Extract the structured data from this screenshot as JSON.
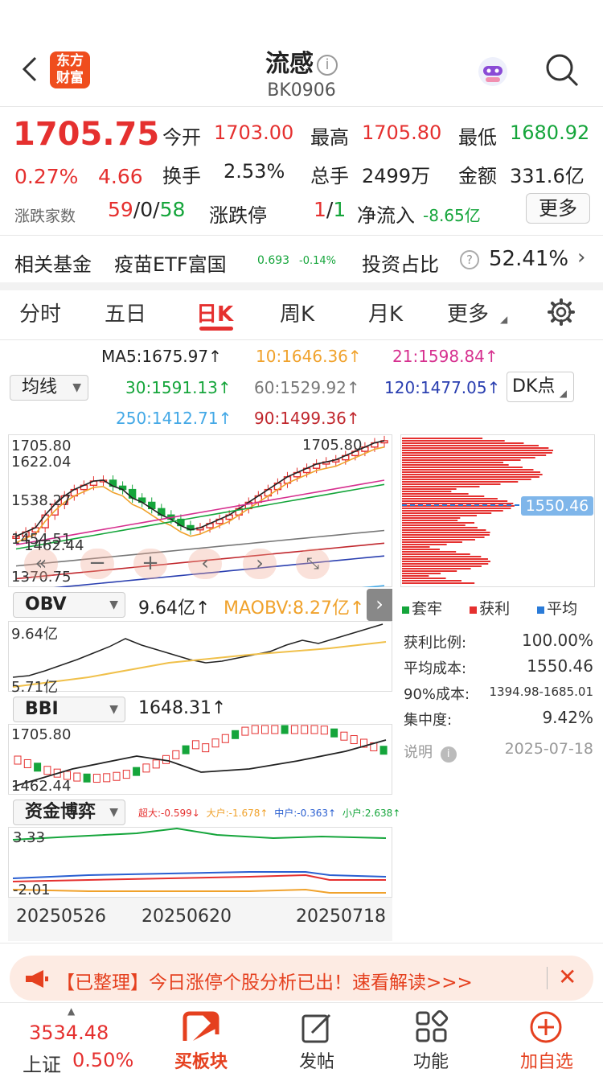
{
  "header": {
    "title": "流感",
    "info_icon": "ⓘ",
    "code": "BK0906",
    "logo_line1": "东方",
    "logo_line2": "财富"
  },
  "quote": {
    "price": "1705.75",
    "pct": "0.27%",
    "chg": "4.66",
    "open_label": "今开",
    "open": "1703.00",
    "high_label": "最高",
    "high": "1705.80",
    "low_label": "最低",
    "low": "1680.92",
    "turnover_label": "换手",
    "turnover": "2.53%",
    "volume_label": "总手",
    "volume": "2499万",
    "amount_label": "金额",
    "amount": "331.6亿",
    "updown_label": "涨跌家数",
    "up_count": "59",
    "flat_count": "0",
    "down_count": "58",
    "slash": "/",
    "limit_label": "涨跌停",
    "limit_up": "1",
    "limit_down": "1",
    "netflow_label": "净流入",
    "netflow": "-8.65亿",
    "more_label": "更多"
  },
  "fund": {
    "label": "相关基金",
    "name": "疫苗ETF富国",
    "price": "0.693",
    "pct": "-0.14%",
    "ratio_label": "投资占比",
    "ratio": "52.41%"
  },
  "tabs": [
    {
      "label": "分时"
    },
    {
      "label": "五日"
    },
    {
      "label": "日K"
    },
    {
      "label": "周K"
    },
    {
      "label": "月K"
    },
    {
      "label": "更多"
    }
  ],
  "ma": {
    "selector": "均线",
    "ma5": "MA5:1675.97↑",
    "ma10": "10:1646.36↑",
    "ma21": "21:1598.84↑",
    "ma30": "30:1591.13↑",
    "ma60": "60:1529.92↑",
    "ma120": "120:1477.05↑",
    "ma250": "250:1412.71↑",
    "ma90": "90:1499.36↑",
    "dk": "DK点"
  },
  "kchart": {
    "y_top": "1705.80",
    "y2": "1622.04",
    "y3": "1538.27",
    "y4": "1454.51",
    "y5": "1462.44",
    "y_bottom": "1370.75",
    "last_label": "1705.80"
  },
  "chip": {
    "avg": "1550.46",
    "legend_trap": "套牢",
    "legend_profit": "获利",
    "legend_avg": "平均",
    "profit_ratio_label": "获利比例:",
    "profit_ratio": "100.00%",
    "avg_cost_label": "平均成本:",
    "avg_cost": "1550.46",
    "cost90_label": "90%成本:",
    "cost90": "1394.98-1685.01",
    "conc_label": "集中度:",
    "conc": "9.42%",
    "note_label": "说明",
    "date": "2025-07-18"
  },
  "obv": {
    "selector": "OBV",
    "value": "9.64亿↑",
    "maobv": "MAOBV:8.27亿↑",
    "y_top": "9.64亿",
    "y_bottom": "5.71亿"
  },
  "bbi": {
    "selector": "BBI",
    "value": "1648.31↑",
    "y_top": "1705.80",
    "y_bottom": "1462.44"
  },
  "fund_game": {
    "selector": "资金博弈",
    "super": "超大:-0.599↓",
    "big": "大户:-1.678↑",
    "mid": "中户:-0.363↑",
    "small": "小户:2.638↑",
    "y_top": "3.33",
    "y_bottom": "-2.01"
  },
  "dates": [
    "20250526",
    "20250620",
    "20250718"
  ],
  "banner": {
    "text": "【已整理】今日涨停个股分析已出！速看解读>>>"
  },
  "bottom": {
    "index_value": "3534.48",
    "index_name": "上证",
    "index_pct": "0.50%",
    "nav": [
      {
        "label": "买板块"
      },
      {
        "label": "发帖"
      },
      {
        "label": "功能"
      },
      {
        "label": "加自选"
      }
    ]
  },
  "colors": {
    "red": "#e5302f",
    "green": "#15a53b",
    "orange": "#f0a22c",
    "blue": "#2a5fd1"
  }
}
